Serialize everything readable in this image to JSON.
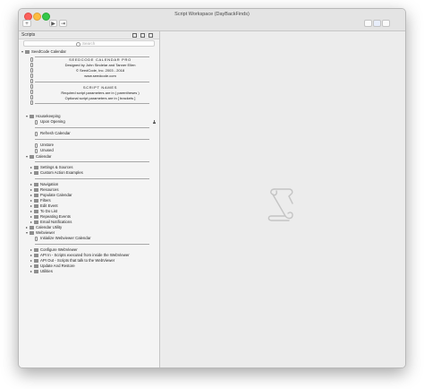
{
  "window": {
    "title": "Script Workspace (DayBackFinds)"
  },
  "toolbar": {
    "new_label": "+",
    "play_label": "▶",
    "step_label": "⇥"
  },
  "sidebar": {
    "title": "Scripts",
    "search_placeholder": "Search",
    "root": "SeedCode Calendar",
    "comments": [
      "SEEDCODE CALENDAR PRO",
      "Designed by John Sindelar and Tanner Ellen",
      "© SeedCode, Inc. 2003 - 2018",
      "www.seedcode.com",
      "SCRIPT NAMES",
      "Required script parameters are in ( parentheses )",
      "Optional script parameters are in [ brackets ]"
    ],
    "housekeeping": "Housekeeping",
    "upon_opening": "Upon Opening",
    "refresh_calendar": "Refresh Calendar",
    "unstore": "Unstore",
    "unused": "Unused",
    "calendar": "Calendar",
    "settings_sources": "Settings & Sources",
    "custom_action_examples": "Custom Action Examples",
    "navigation": "Navigation",
    "resources": "Resources",
    "populate_calendar": "Populate Calendar",
    "filters": "Filters",
    "edit_event": "Edit Event",
    "to_do_list": "To Do List",
    "repeating_events": "Repeating Events",
    "email_notifications": "Email Notifications",
    "calendar_utility": "Calendar Utility",
    "webviewer": "Webviewer",
    "initialize_webviewer": "Initialize Webviewer Calendar",
    "configure_webviewer": "Configure WebViewer",
    "api_in": "API In - Scripts executed from inside the WebViewer",
    "api_out": "API Out - Scripts that talk to the WebViewer",
    "update_restore": "Update And Restore",
    "utilities": "Utilities"
  }
}
